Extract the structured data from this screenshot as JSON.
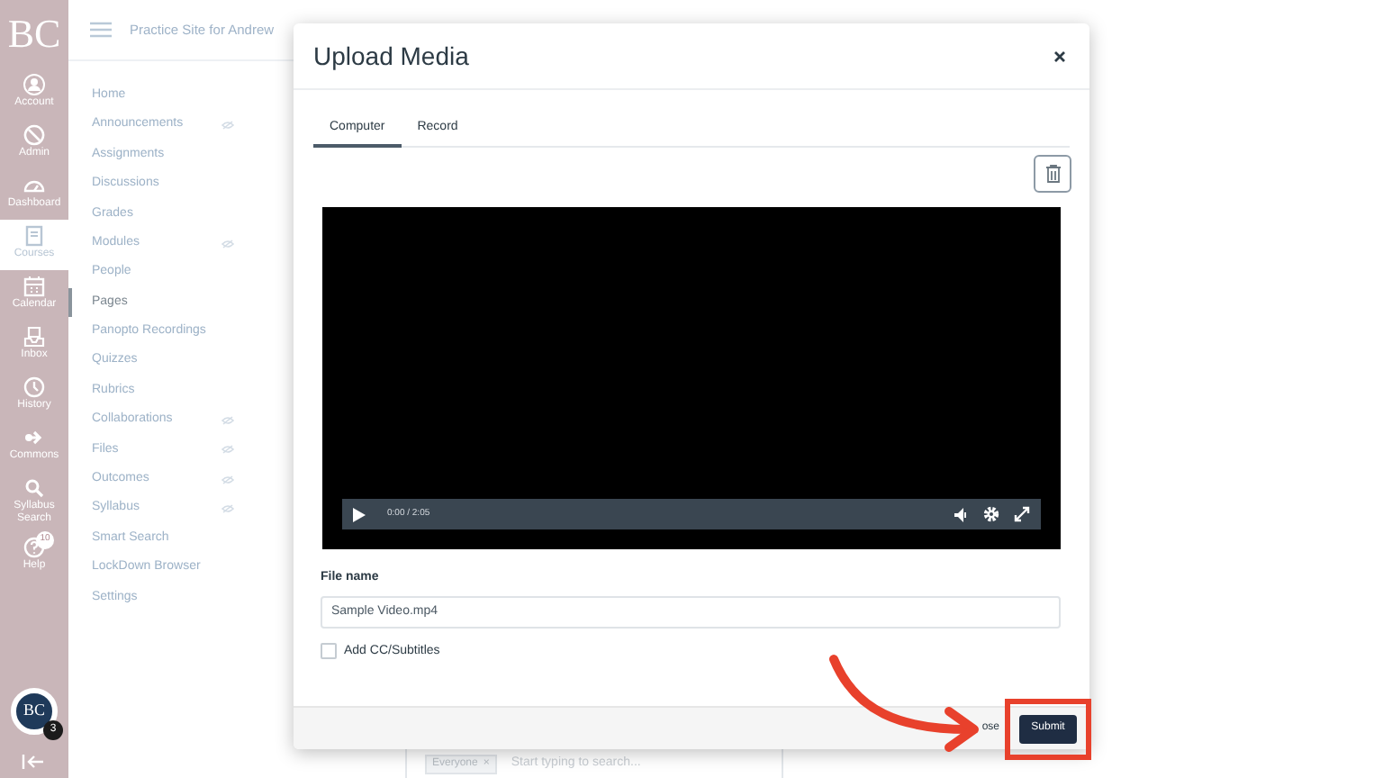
{
  "global_nav": {
    "logo": "BC",
    "items": [
      {
        "kind": "account",
        "label": "Account",
        "selected": false
      },
      {
        "kind": "admin",
        "label": "Admin",
        "selected": false
      },
      {
        "kind": "dashboard",
        "label": "Dashboard",
        "selected": false
      },
      {
        "kind": "courses",
        "label": "Courses",
        "selected": true
      },
      {
        "kind": "calendar",
        "label": "Calendar",
        "selected": false
      },
      {
        "kind": "inbox",
        "label": "Inbox",
        "selected": false
      },
      {
        "kind": "history",
        "label": "History",
        "selected": false
      },
      {
        "kind": "commons",
        "label": "Commons",
        "selected": false
      },
      {
        "kind": "search",
        "label": "Syllabus Search",
        "selected": false
      },
      {
        "kind": "help",
        "label": "Help",
        "selected": false,
        "badge": "10"
      }
    ],
    "avatar": {
      "initials": "BC",
      "badge": "3"
    }
  },
  "course_header": {
    "title": "Practice Site for Andrew"
  },
  "course_nav": [
    {
      "label": "Home",
      "selected": false,
      "hidden": false
    },
    {
      "label": "Announcements",
      "selected": false,
      "hidden": true
    },
    {
      "label": "Assignments",
      "selected": false,
      "hidden": false
    },
    {
      "label": "Discussions",
      "selected": false,
      "hidden": false
    },
    {
      "label": "Grades",
      "selected": false,
      "hidden": false
    },
    {
      "label": "Modules",
      "selected": false,
      "hidden": true
    },
    {
      "label": "People",
      "selected": false,
      "hidden": false
    },
    {
      "label": "Pages",
      "selected": true,
      "hidden": false
    },
    {
      "label": "Panopto Recordings",
      "selected": false,
      "hidden": false
    },
    {
      "label": "Quizzes",
      "selected": false,
      "hidden": false
    },
    {
      "label": "Rubrics",
      "selected": false,
      "hidden": false
    },
    {
      "label": "Collaborations",
      "selected": false,
      "hidden": true
    },
    {
      "label": "Files",
      "selected": false,
      "hidden": true
    },
    {
      "label": "Outcomes",
      "selected": false,
      "hidden": true
    },
    {
      "label": "Syllabus",
      "selected": false,
      "hidden": true
    },
    {
      "label": "Smart Search",
      "selected": false,
      "hidden": false
    },
    {
      "label": "LockDown Browser",
      "selected": false,
      "hidden": false
    },
    {
      "label": "Settings",
      "selected": false,
      "hidden": false
    }
  ],
  "page_behind": {
    "audience_chip": "Everyone",
    "chip_remove": "×",
    "search": {
      "placeholder": "Start typing to search..."
    }
  },
  "modal": {
    "title": "Upload Media",
    "tabs": [
      {
        "label": "Computer",
        "selected": true
      },
      {
        "label": "Record",
        "selected": false
      }
    ],
    "video": {
      "time": "0:00 / 2:05"
    },
    "file_name": {
      "label": "File name",
      "value": "Sample Video.mp4"
    },
    "subtitles": {
      "label": "Add CC/Subtitles",
      "checked": false
    },
    "footer": {
      "close": "ose",
      "submit": "Submit"
    }
  }
}
